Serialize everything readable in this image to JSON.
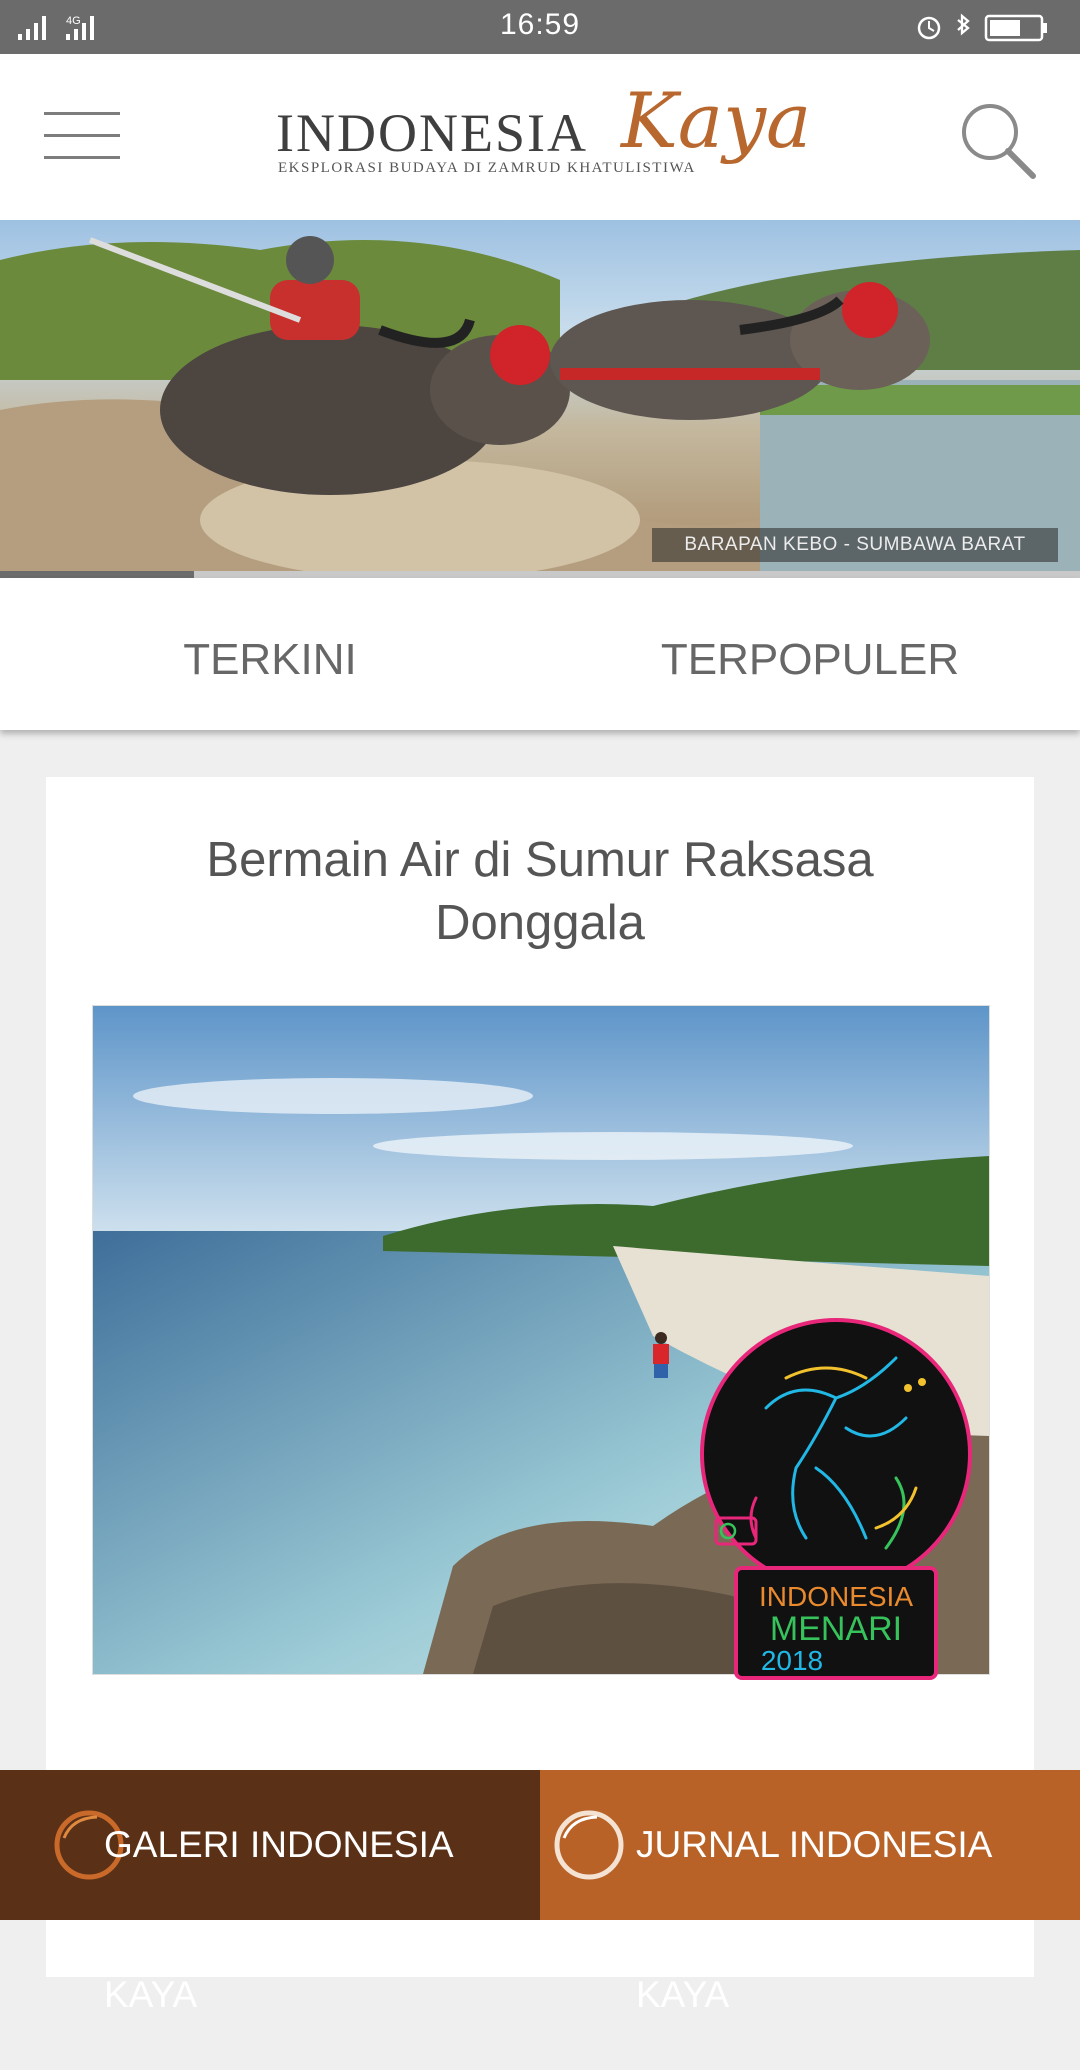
{
  "status_bar": {
    "time": "16:59",
    "network": "4G",
    "icons": [
      "signal-icon",
      "alarm-icon",
      "bluetooth-icon",
      "battery-icon"
    ]
  },
  "header": {
    "logo_word": "INDONESIA",
    "logo_script": "Kaya",
    "logo_tagline": "EKSPLORASI BUDAYA DI ZAMRUD KHATULISTIWA",
    "icons": [
      "menu-icon",
      "search-icon"
    ]
  },
  "hero": {
    "caption": "BARAPAN KEBO - SUMBAWA BARAT",
    "slide_progress": 0.18
  },
  "tabs": [
    {
      "label": "TERKINI"
    },
    {
      "label": "TERPOPULER"
    }
  ],
  "article": {
    "title": "Bermain Air di Sumur Raksasa Donggala",
    "badge_line1": "INDONESIA",
    "badge_line2": "MENARI",
    "badge_year": "2018"
  },
  "bottom_nav": [
    {
      "label": "GALERI INDONESIA KAYA"
    },
    {
      "label": "JURNAL INDONESIA KAYA"
    }
  ],
  "colors": {
    "brand_orange": "#b96227",
    "brand_brown": "#5a3017",
    "status_bar": "#6b6b6b"
  }
}
